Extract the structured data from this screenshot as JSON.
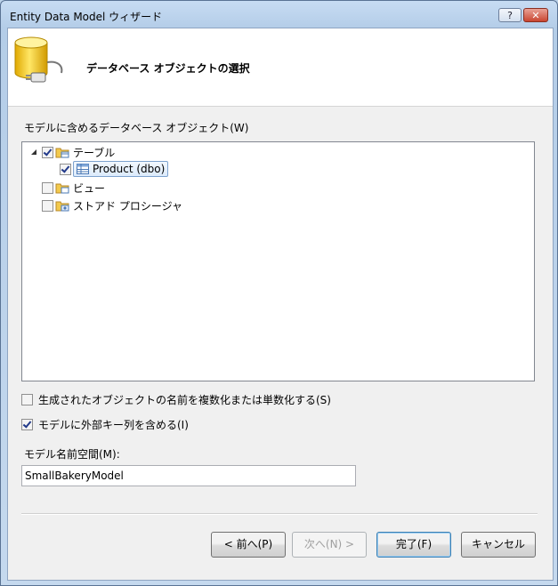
{
  "window": {
    "title": "Entity Data Model ウィザード",
    "help_label": "?",
    "close_label": "✕"
  },
  "header": {
    "title": "データベース オブジェクトの選択"
  },
  "objects": {
    "label": "モデルに含めるデータベース オブジェクト(W)",
    "tree": [
      {
        "label": "テーブル",
        "checked": true,
        "expanded": true,
        "children": [
          {
            "label": "Product (dbo)",
            "checked": true,
            "selected": true
          }
        ]
      },
      {
        "label": "ビュー",
        "checked": false
      },
      {
        "label": "ストアド プロシージャ",
        "checked": false
      }
    ]
  },
  "options": {
    "pluralize_label": "生成されたオブジェクトの名前を複数化または単数化する(S)",
    "pluralize_checked": false,
    "foreign_keys_label": "モデルに外部キー列を含める(I)",
    "foreign_keys_checked": true
  },
  "namespace": {
    "label": "モデル名前空間(M):",
    "value": "SmallBakeryModel"
  },
  "buttons": {
    "back": "< 前へ(P)",
    "next": "次へ(N) >",
    "finish": "完了(F)",
    "cancel": "キャンセル"
  },
  "icons": {
    "header": "database-plug-icon",
    "folder": "folder-icon",
    "table": "table-icon"
  }
}
